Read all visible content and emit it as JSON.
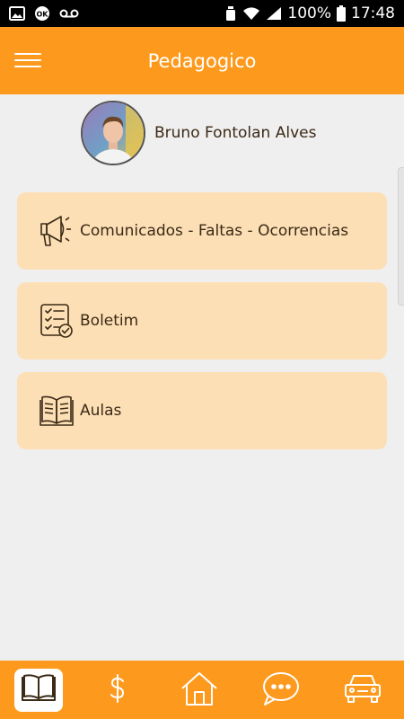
{
  "status_bar": {
    "left_icons": [
      "image-icon",
      "ok-icon",
      "voicemail-icon"
    ],
    "right_icons": [
      "alarm-icon",
      "wifi-icon",
      "signal-icon"
    ],
    "battery": "100%",
    "time": "17:48"
  },
  "app_bar": {
    "title": "Pedagogico",
    "menu_icon": "hamburger-menu-icon"
  },
  "profile": {
    "name": "Bruno Fontolan Alves"
  },
  "menu": {
    "items": [
      {
        "label": "Comunicados - Faltas - Ocorrencias",
        "icon": "megaphone-icon"
      },
      {
        "label": "Boletim",
        "icon": "checklist-icon"
      },
      {
        "label": "Aulas",
        "icon": "book-icon"
      }
    ]
  },
  "bottom_nav": {
    "items": [
      {
        "icon": "book-icon",
        "active": true
      },
      {
        "icon": "dollar-icon",
        "active": false
      },
      {
        "icon": "home-icon",
        "active": false
      },
      {
        "icon": "chat-icon",
        "active": false
      },
      {
        "icon": "car-icon",
        "active": false
      }
    ]
  },
  "colors": {
    "primary": "#fd9a1d",
    "card": "#fddfb6",
    "background": "#efefef",
    "text": "#3b2a16"
  }
}
